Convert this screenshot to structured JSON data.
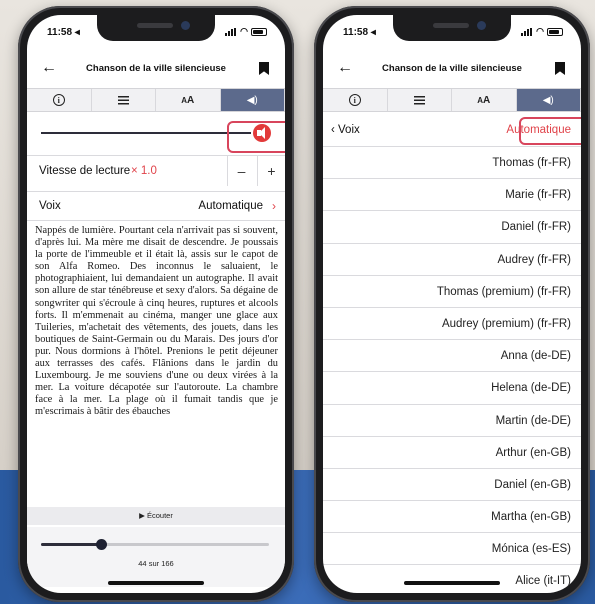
{
  "status": {
    "time": "11:58 ◂"
  },
  "left": {
    "title": "Chanson de la ville silencieuse",
    "speed_label": "Vitesse de lecture",
    "speed_value": "× 1.0",
    "minus": "–",
    "plus": "+",
    "voice_label": "Voix",
    "voice_value": "Automatique",
    "voice_chevron": "›",
    "body_text": "Nappés de lumière. Pourtant cela n'arrivait pas si souvent, d'après lui. Ma mère me disait de descendre. Je poussais la porte de l'immeuble et il était là, assis sur le capot de son Alfa Romeo. Des inconnus le saluaient, le photographiaient, lui demandaient un autographe. Il avait son allure de star ténébreuse et sexy d'alors. Sa dégaine de songwriter qui s'écroule à cinq heures, ruptures et alcools forts. Il m'emmenait au cinéma, manger une glace aux Tuileries, m'achetait des vêtements, des jouets, dans les boutiques de Saint-Germain ou du Marais. Des jours d'or pur. Nous dormions à l'hôtel. Prenions le petit déjeuner aux terrasses des cafés. Flânions dans le jardin du Luxembourg. Je me souviens d'une ou deux virées à la mer. La voiture décapotée sur l'autoroute. La chambre face à la mer. La plage où il fumait tandis que je m'escrimais à bâtir des ébauches",
    "listen": "▶ Écouter",
    "pages": "44 sur 166",
    "progress_fraction": 0.265
  },
  "right": {
    "title": "Chanson de la ville silencieuse",
    "back_label": "‹  Voix",
    "selected": "Automatique",
    "voices": [
      "Thomas (fr-FR)",
      "Marie (fr-FR)",
      "Daniel (fr-FR)",
      "Audrey (fr-FR)",
      "Thomas (premium) (fr-FR)",
      "Audrey (premium) (fr-FR)",
      "Anna (de-DE)",
      "Helena (de-DE)",
      "Martin (de-DE)",
      "Arthur (en-GB)",
      "Daniel (en-GB)",
      "Martha (en-GB)",
      "Mónica (es-ES)",
      "Alice (it-IT)"
    ]
  },
  "tabs": {
    "aa_small": "A",
    "aa_big": "A"
  },
  "colors": {
    "accent": "#e0434a",
    "tab_active": "#5c6a8c",
    "highlight": "#d8455c"
  }
}
